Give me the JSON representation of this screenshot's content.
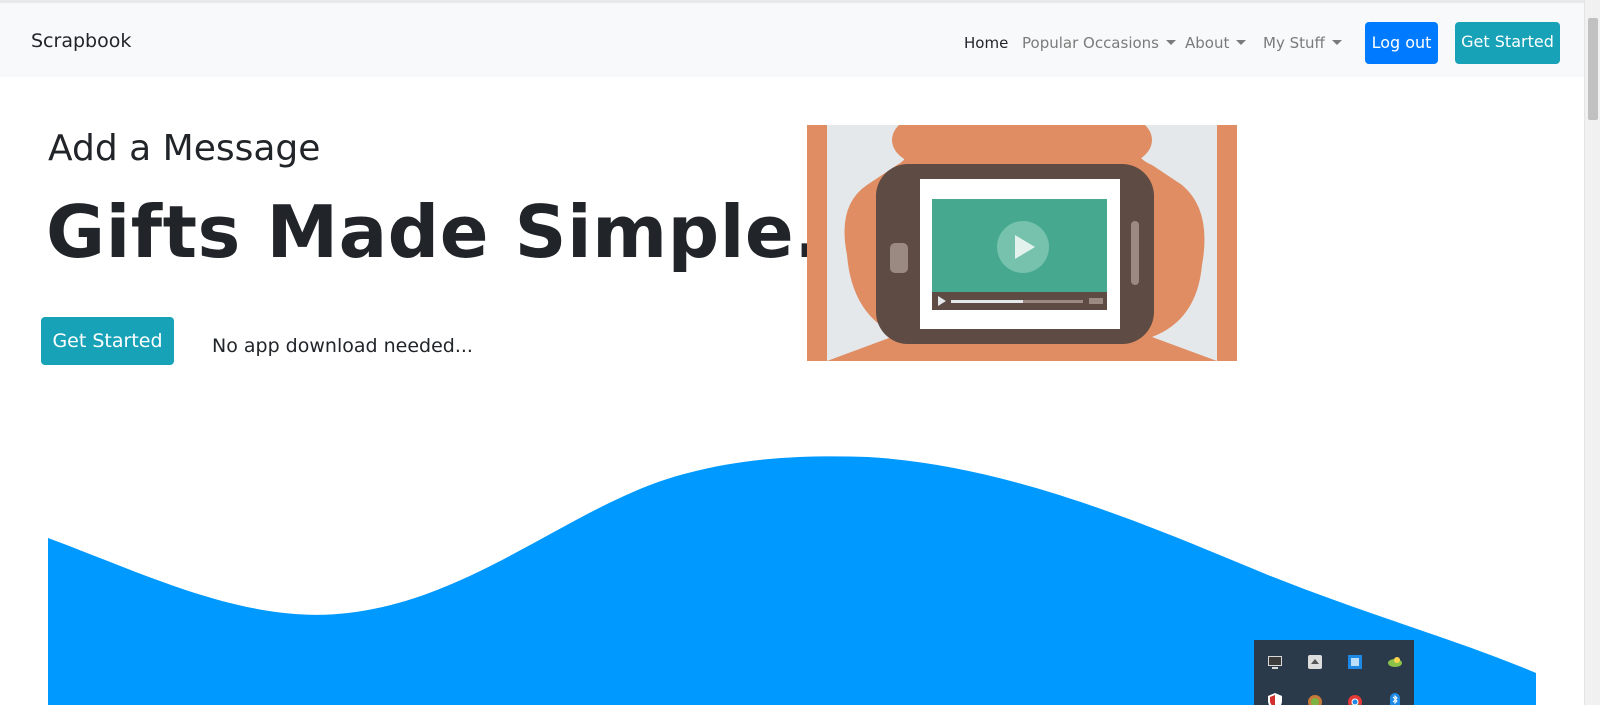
{
  "navbar": {
    "brand": "Scrapbook",
    "items": [
      {
        "label": "Home",
        "active": true,
        "dropdown": false
      },
      {
        "label": "Popular Occasions",
        "active": false,
        "dropdown": true
      },
      {
        "label": "About",
        "active": false,
        "dropdown": true
      },
      {
        "label": "My Stuff",
        "active": false,
        "dropdown": true
      }
    ],
    "logout_label": "Log out",
    "get_started_label": "Get Started"
  },
  "hero": {
    "subtitle": "Add a Message",
    "headline": "Gifts Made Simple.",
    "cta_label": "Get Started",
    "tagline": "No app download needed...",
    "image_icon": "phone-video-illustration"
  },
  "colors": {
    "primary": "#007bff",
    "info": "#17a2b8",
    "wave": "#0099ff",
    "navbar_bg": "#f8f9fa",
    "text_dark": "#212529",
    "text_muted": "#7b7b7b"
  },
  "tray": {
    "icons": [
      "monitor-icon",
      "cloud-sync-icon",
      "network-icon",
      "drive-icon",
      "shield-icon",
      "app-icon",
      "chrome-icon",
      "bluetooth-icon"
    ]
  }
}
